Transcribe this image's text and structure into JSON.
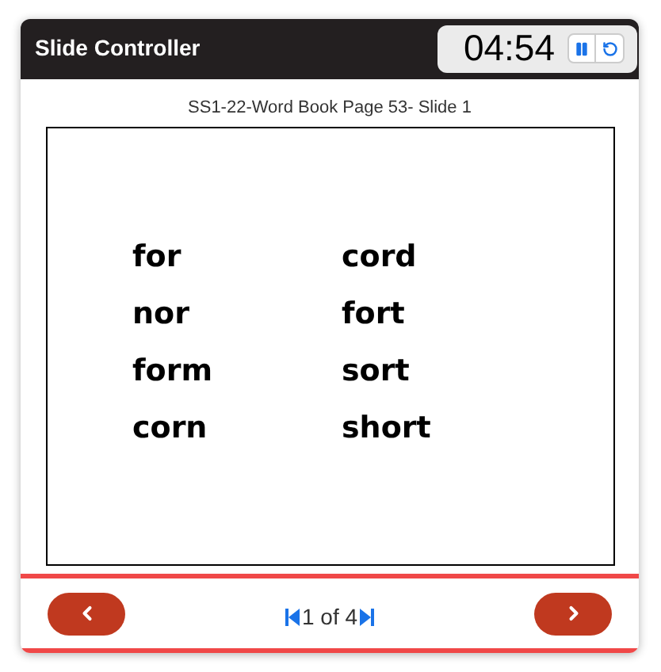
{
  "window": {
    "title": "Slide Controller"
  },
  "timer": {
    "time": "04:54"
  },
  "slide": {
    "caption": "SS1-22-Word Book Page 53- Slide 1",
    "columns": [
      [
        "for",
        "nor",
        "form",
        "corn"
      ],
      [
        "cord",
        "fort",
        "sort",
        "short"
      ]
    ]
  },
  "footer": {
    "highlighted": true,
    "page": "1 of 4"
  }
}
